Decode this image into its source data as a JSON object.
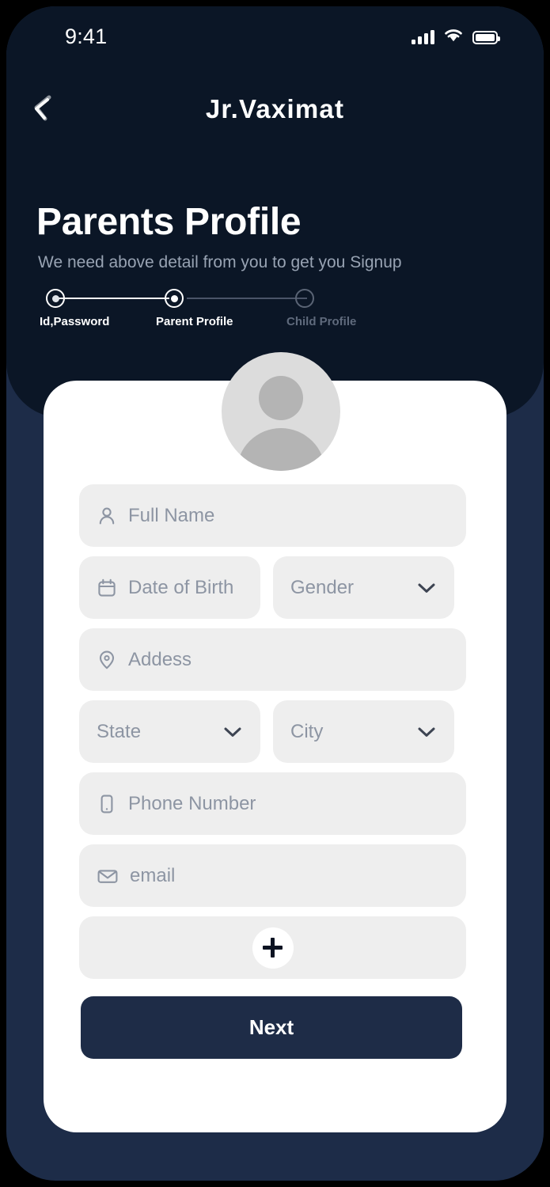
{
  "status_bar": {
    "time": "9:41",
    "cellular_icon": "signal-bars-icon",
    "wifi_icon": "wifi-icon",
    "battery_icon": "battery-full-icon"
  },
  "nav": {
    "back_icon": "back-chevron-icon",
    "app_title": "Jr.Vaximat"
  },
  "header": {
    "title": "Parents Profile",
    "subtitle": "We need above detail from you to get you Signup"
  },
  "stepper": {
    "steps": [
      {
        "label": "Id,Password",
        "state": "completed"
      },
      {
        "label": "Parent Profile",
        "state": "active"
      },
      {
        "label": "Child Profile",
        "state": "inactive"
      }
    ]
  },
  "avatar": {
    "icon": "user-avatar-placeholder-icon"
  },
  "form": {
    "fields": [
      {
        "name": "full-name",
        "placeholder": "Full Name",
        "value": "",
        "icon": "person-icon",
        "type": "text"
      },
      {
        "name": "date-of-birth",
        "placeholder": "Date of Birth",
        "value": "",
        "icon": "calendar-icon",
        "type": "text"
      },
      {
        "name": "gender",
        "placeholder": "Gender",
        "value": "",
        "icon": "chevron-down-icon",
        "type": "select"
      },
      {
        "name": "address",
        "placeholder": "Addess",
        "value": "",
        "icon": "location-pin-icon",
        "type": "text"
      },
      {
        "name": "state",
        "placeholder": "State",
        "value": "",
        "icon": "chevron-down-icon",
        "type": "select"
      },
      {
        "name": "city",
        "placeholder": "City",
        "value": "",
        "icon": "chevron-down-icon",
        "type": "select"
      },
      {
        "name": "phone-number",
        "placeholder": "Phone Number",
        "value": "",
        "icon": "mobile-phone-icon",
        "type": "tel"
      },
      {
        "name": "email",
        "placeholder": "email",
        "value": "",
        "icon": "envelope-icon",
        "type": "email"
      }
    ],
    "add_button_icon": "plus-icon",
    "next_label": "Next"
  },
  "colors": {
    "header_navy": "#0b1626",
    "page_navy": "#1d2c48",
    "card_white": "#ffffff",
    "field_gray": "#eeeeee",
    "placeholder_gray": "#8d95a3",
    "button_navy": "#1e2c47",
    "avatar_gray": "#dcdcdc",
    "avatar_figure_gray": "#b4b4b4",
    "step_inactive": "#5f6a7c",
    "subtitle_gray": "#98a3b3"
  }
}
